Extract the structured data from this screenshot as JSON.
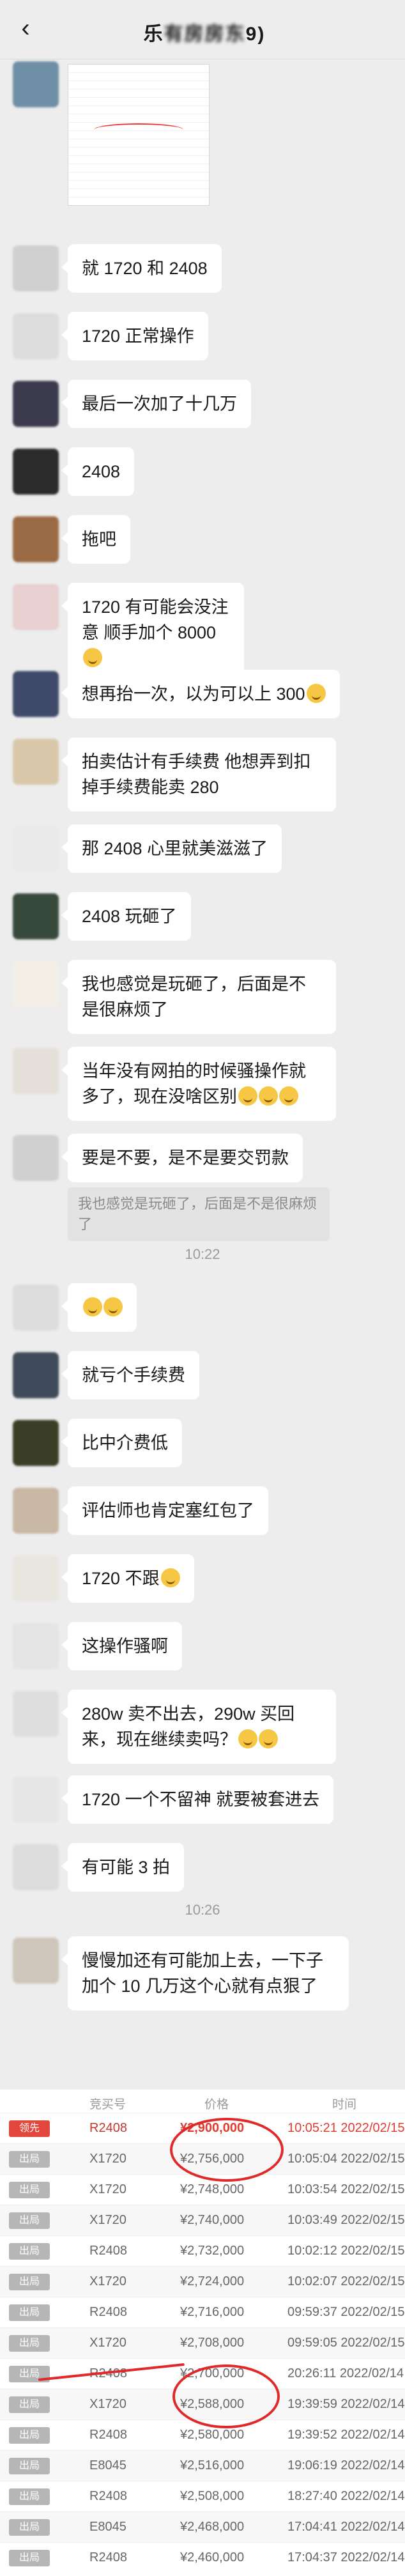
{
  "header": {
    "title_prefix": "乐",
    "title_blurred": "有房房东",
    "title_suffix": "9)"
  },
  "messages": [
    {
      "text": "就 1720 和 2408"
    },
    {
      "text": "1720 正常操作"
    },
    {
      "text": "最后一次加了十几万"
    },
    {
      "text": "2408"
    },
    {
      "text": "拖吧"
    },
    {
      "text": "1720 有可能会没注意  顺手加个 8000"
    },
    {
      "text": "想再抬一次，以为可以上 300"
    },
    {
      "text": "拍卖估计有手续费 他想弄到扣掉手续费能卖 280"
    },
    {
      "text": "那 2408 心里就美滋滋了"
    },
    {
      "text": "2408 玩砸了"
    },
    {
      "text": "我也感觉是玩砸了，后面是不是很麻烦了"
    },
    {
      "text": "当年没有网拍的时候骚操作就多了，现在没啥区别"
    },
    {
      "text": "要是不要，是不是要交罚款"
    },
    {
      "quote": "我也感觉是玩砸了，后面是不是很麻烦了"
    },
    {
      "time": "10:22"
    },
    {
      "text": ""
    },
    {
      "text": "就亏个手续费"
    },
    {
      "text": "比中介费低"
    },
    {
      "text": "评估师也肯定塞红包了"
    },
    {
      "text": "1720 不跟"
    },
    {
      "text": "这操作骚啊"
    },
    {
      "text": "280w 卖不出去，290w 买回来，现在继续卖吗？"
    },
    {
      "text": "1720 一个不留神  就要被套进去"
    },
    {
      "text": "有可能 3 拍"
    },
    {
      "time": "10:26"
    },
    {
      "text": "慢慢加还有可能加上去，一下子加个 10 几万这个心就有点狠了"
    }
  ],
  "table": {
    "headers": {
      "bidder": "竞买号",
      "price": "价格",
      "time": "时间"
    },
    "rows": [
      {
        "status": "领先",
        "bidder": "R2408",
        "price": "¥2,900,000",
        "time": "10:05:21 2022/02/15"
      },
      {
        "status": "出局",
        "bidder": "X1720",
        "price": "¥2,756,000",
        "time": "10:05:04 2022/02/15"
      },
      {
        "status": "出局",
        "bidder": "X1720",
        "price": "¥2,748,000",
        "time": "10:03:54 2022/02/15"
      },
      {
        "status": "出局",
        "bidder": "X1720",
        "price": "¥2,740,000",
        "time": "10:03:49 2022/02/15"
      },
      {
        "status": "出局",
        "bidder": "R2408",
        "price": "¥2,732,000",
        "time": "10:02:12 2022/02/15"
      },
      {
        "status": "出局",
        "bidder": "X1720",
        "price": "¥2,724,000",
        "time": "10:02:07 2022/02/15"
      },
      {
        "status": "出局",
        "bidder": "R2408",
        "price": "¥2,716,000",
        "time": "09:59:37 2022/02/15"
      },
      {
        "status": "出局",
        "bidder": "X1720",
        "price": "¥2,708,000",
        "time": "09:59:05 2022/02/15"
      },
      {
        "status": "出局",
        "bidder": "R2408",
        "price": "¥2,700,000",
        "time": "20:26:11 2022/02/14"
      },
      {
        "status": "出局",
        "bidder": "X1720",
        "price": "¥2,588,000",
        "time": "19:39:59 2022/02/14"
      },
      {
        "status": "出局",
        "bidder": "R2408",
        "price": "¥2,580,000",
        "time": "19:39:52 2022/02/14"
      },
      {
        "status": "出局",
        "bidder": "E8045",
        "price": "¥2,516,000",
        "time": "19:06:19 2022/02/14"
      },
      {
        "status": "出局",
        "bidder": "R2408",
        "price": "¥2,508,000",
        "time": "18:27:40 2022/02/14"
      },
      {
        "status": "出局",
        "bidder": "E8045",
        "price": "¥2,468,000",
        "time": "17:04:41 2022/02/14"
      },
      {
        "status": "出局",
        "bidder": "R2408",
        "price": "¥2,460,000",
        "time": "17:04:37 2022/02/14"
      }
    ]
  },
  "colors": {
    "lead": "#e2473d",
    "out": "#b6b6b6",
    "mark": "#e02a2a"
  }
}
